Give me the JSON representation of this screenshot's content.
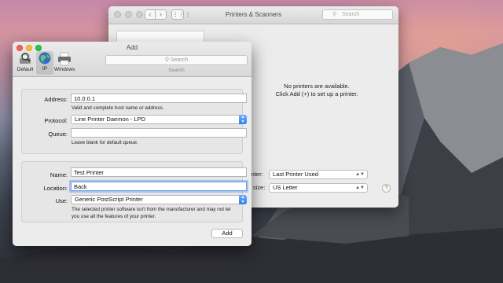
{
  "desktop": {
    "name": "Yosemite wallpaper"
  },
  "printers_window": {
    "title": "Printers & Scanners",
    "search_placeholder": "Search",
    "empty_message_1": "No printers are available.",
    "empty_message_2": "Click Add (+) to set up a printer.",
    "default_printer_label": "inter:",
    "default_printer_value": "Last Printer Used",
    "paper_size_label": "size:",
    "paper_size_value": "US Letter",
    "help_glyph": "?"
  },
  "add_window": {
    "title": "Add",
    "toolbar": [
      {
        "label": "Default",
        "icon": "magnifier-printer-icon"
      },
      {
        "label": "IP",
        "icon": "globe-icon",
        "selected": true
      },
      {
        "label": "Windows",
        "icon": "printer-icon"
      }
    ],
    "search_placeholder": "Search",
    "search_label": "Search",
    "address_label": "Address:",
    "address_value": "10.0.0.1",
    "address_hint": "Valid and complete host name or address.",
    "protocol_label": "Protocol:",
    "protocol_value": "Line Printer Daemon - LPD",
    "queue_label": "Queue:",
    "queue_value": "",
    "queue_hint": "Leave blank for default queue.",
    "name_label": "Name:",
    "name_value": "Test Printer",
    "location_label": "Location:",
    "location_value": "Back",
    "use_label": "Use:",
    "use_value": "Generic PostScript Printer",
    "use_hint_1": "The selected printer software isn't from the manufacturer and may not let",
    "use_hint_2": "you use all the features of your printer.",
    "add_button": "Add"
  },
  "colors": {
    "accent": "#2f7fe8",
    "focus_ring": "#6aa0e8",
    "close": "#fc5f57",
    "minimize": "#fdbc2e",
    "zoom": "#29c840"
  }
}
